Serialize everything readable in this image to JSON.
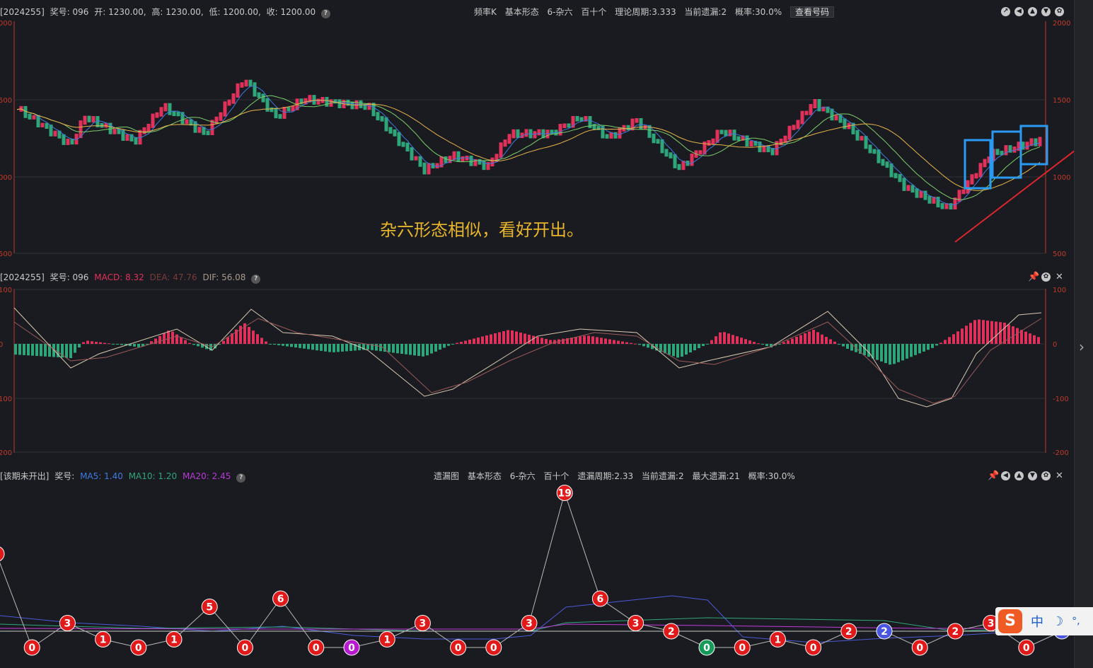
{
  "colors": {
    "up": "#e0315a",
    "down": "#2fa67a",
    "ma5": "#3d7be0",
    "ma10": "#7ccf6a",
    "ma20": "#e8b44a",
    "grid": "#2e3036",
    "axis": "#c0392b",
    "box": "#2a9bf2",
    "arrow": "#d9262e",
    "annot": "#e8b62a"
  },
  "pane1": {
    "header": {
      "issue": "[2024255]",
      "prize": "奖号: 096",
      "open": "开: 1230.00,",
      "high": "高: 1230.00,",
      "low": "低: 1200.00,",
      "close": "收: 1200.00"
    },
    "center": {
      "type": "频率K",
      "form": "基本形态",
      "subform": "6-杂六",
      "pos": "百十个",
      "period": "理论周期:3.333",
      "current": "当前遗漏:2",
      "prob": "概率:30.0%",
      "btn": "查看号码"
    },
    "right_ticks": [
      "2000",
      "1500",
      "1000",
      "500"
    ],
    "left_ticks": [
      "000",
      "500",
      "000",
      "500"
    ],
    "annotation": "杂六形态相似，看好开出。"
  },
  "pane2": {
    "header": {
      "issue": "[2024255]",
      "prize": "奖号: 096",
      "macd": "MACD: 8.32",
      "dea": "DEA: 47.76",
      "dif": "DIF: 56.08"
    },
    "right_ticks": [
      "100",
      "0",
      "-100",
      "-200"
    ],
    "left_ticks": [
      "100",
      "0",
      "100",
      "200"
    ]
  },
  "pane3": {
    "header": {
      "issue": "[该期未开出]",
      "prize": "奖号:",
      "ma5": "MA5: 1.40",
      "ma10": "MA10: 1.20",
      "ma20": "MA20: 2.45"
    },
    "center": {
      "type": "遗漏图",
      "form": "基本形态",
      "subform": "6-杂六",
      "pos": "百十个",
      "period": "遗漏周期:2.33",
      "current": "当前遗漏:2",
      "max": "最大遗漏:21",
      "prob": "概率:30.0%"
    }
  },
  "miss_points": [
    {
      "v": "",
      "c": "red"
    },
    {
      "v": "0",
      "c": "red"
    },
    {
      "v": "3",
      "c": "red"
    },
    {
      "v": "1",
      "c": "red"
    },
    {
      "v": "0",
      "c": "red"
    },
    {
      "v": "1",
      "c": "red"
    },
    {
      "v": "5",
      "c": "red"
    },
    {
      "v": "0",
      "c": "red"
    },
    {
      "v": "6",
      "c": "red"
    },
    {
      "v": "0",
      "c": "red"
    },
    {
      "v": "0",
      "c": "purple"
    },
    {
      "v": "1",
      "c": "red"
    },
    {
      "v": "3",
      "c": "red"
    },
    {
      "v": "0",
      "c": "red"
    },
    {
      "v": "0",
      "c": "red"
    },
    {
      "v": "3",
      "c": "red"
    },
    {
      "v": "19",
      "c": "red"
    },
    {
      "v": "6",
      "c": "red"
    },
    {
      "v": "3",
      "c": "red"
    },
    {
      "v": "2",
      "c": "red"
    },
    {
      "v": "0",
      "c": "green"
    },
    {
      "v": "0",
      "c": "red"
    },
    {
      "v": "1",
      "c": "red"
    },
    {
      "v": "0",
      "c": "red"
    },
    {
      "v": "2",
      "c": "red"
    },
    {
      "v": "2",
      "c": "blue"
    },
    {
      "v": "0",
      "c": "red"
    },
    {
      "v": "2",
      "c": "red"
    },
    {
      "v": "3",
      "c": "red"
    },
    {
      "v": "0",
      "c": "red"
    },
    {
      "v": "2",
      "c": "blue"
    }
  ],
  "ime": {
    "logo": "S",
    "zh": "中",
    "moon": "☽",
    "punc": "°,"
  }
}
